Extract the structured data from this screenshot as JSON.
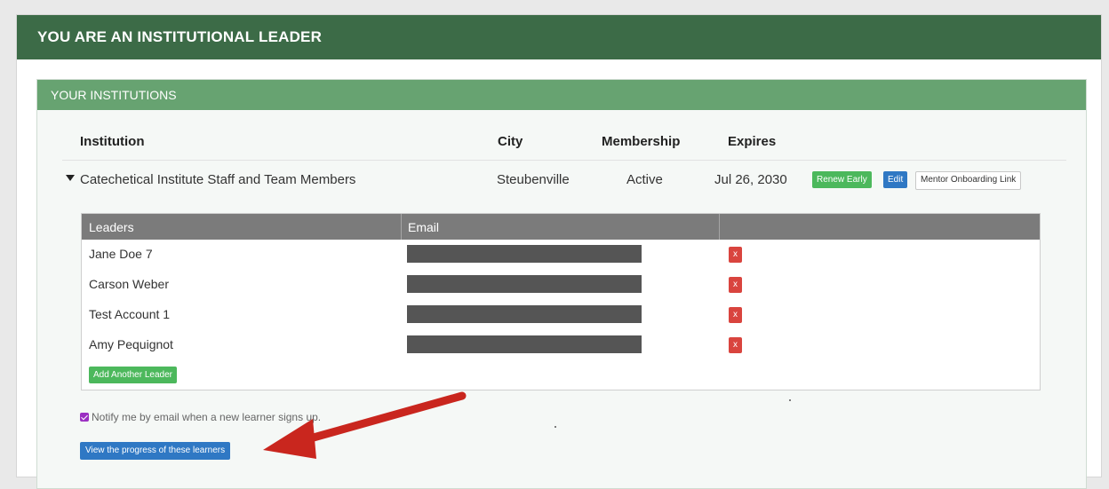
{
  "header": {
    "title": "YOU ARE AN INSTITUTIONAL LEADER"
  },
  "institutions": {
    "title": "YOUR INSTITUTIONS",
    "columns": {
      "institution": "Institution",
      "city": "City",
      "membership": "Membership",
      "expires": "Expires"
    },
    "rows": [
      {
        "name": "Catechetical Institute Staff and Team Members",
        "city": "Steubenville",
        "membership": "Active",
        "expires": "Jul 26, 2030",
        "buttons": {
          "renew": "Renew Early",
          "edit": "Edit",
          "mentor_link": "Mentor Onboarding Link"
        }
      }
    ]
  },
  "leaders": {
    "columns": {
      "leaders": "Leaders",
      "email": "Email"
    },
    "rows": [
      {
        "name": "Jane Doe 7",
        "remove": "x"
      },
      {
        "name": "Carson Weber",
        "remove": "x"
      },
      {
        "name": "Test Account 1",
        "remove": "x"
      },
      {
        "name": "Amy Pequignot",
        "remove": "x"
      }
    ],
    "add_button": "Add Another Leader"
  },
  "notify": {
    "label": "Notify me by email when a new learner signs up.",
    "checked": true
  },
  "view_progress_button": "View the progress of these learners",
  "colors": {
    "header_green": "#3c6b47",
    "panel_green": "#67a371",
    "success": "#4cb85c",
    "primary": "#2f78c4",
    "danger": "#d9443e",
    "annotation_arrow": "#c9261e"
  },
  "icons": {
    "expand": "caret-down-icon",
    "checkbox": "checkbox-checked-icon",
    "annotation": "red-arrow-icon"
  }
}
